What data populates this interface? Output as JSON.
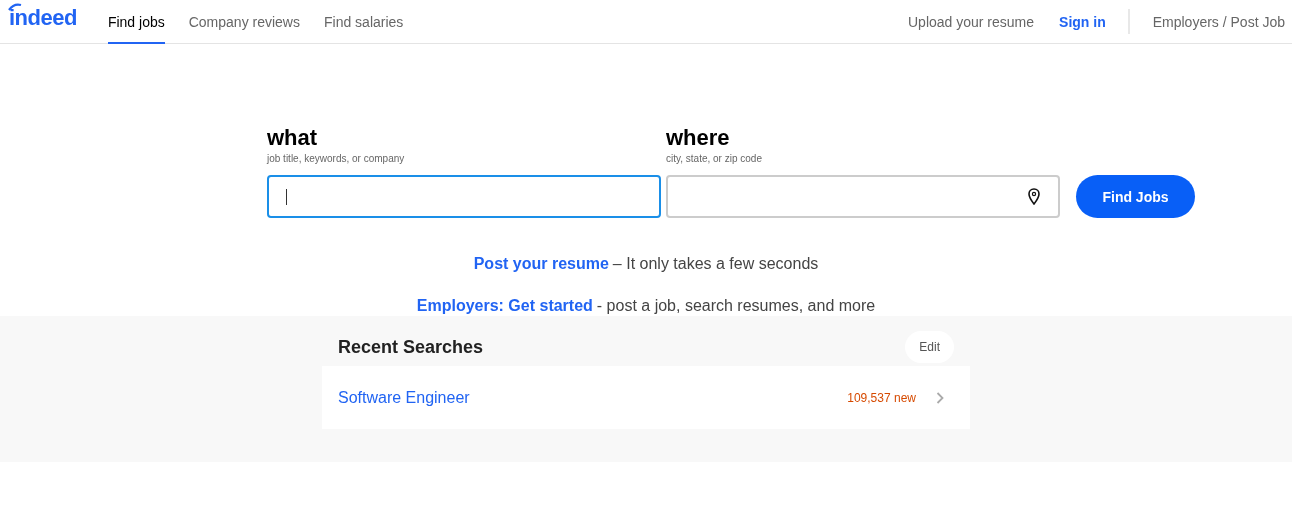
{
  "header": {
    "logo": "indeed",
    "nav": [
      {
        "label": "Find jobs",
        "selected": true
      },
      {
        "label": "Company reviews",
        "selected": false
      },
      {
        "label": "Find salaries",
        "selected": false
      }
    ],
    "upload_link": "Upload your resume",
    "sign_in": "Sign in",
    "employers_link": "Employers / Post Job"
  },
  "search": {
    "fields": [
      {
        "label": "what",
        "hint": "job title, keywords, or company",
        "focused": true,
        "kind": "text"
      },
      {
        "label": "where",
        "hint": "city, state, or zip code",
        "focused": false,
        "kind": "location"
      }
    ],
    "button": "Find Jobs"
  },
  "promos": [
    {
      "link": "Post your resume",
      "text": "– It only takes a few seconds"
    },
    {
      "link": "Employers: Get started",
      "text": "- post a job, search resumes, and more"
    }
  ],
  "recent_searches": {
    "title": "Recent Searches",
    "edit": "Edit",
    "items": [
      {
        "query": "Software Engineer",
        "count": "109,537 new"
      }
    ]
  }
}
